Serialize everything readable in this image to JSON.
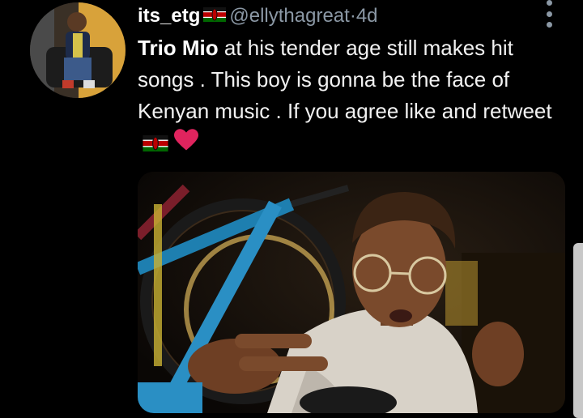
{
  "tweet": {
    "display_name": "its_etg",
    "handle": "@ellythagreat",
    "separator": " · ",
    "time": "4d",
    "text_bold": "Trio Mio",
    "text_body": " at his tender age still makes hit songs . This boy is gonna be the face of Kenyan music . If you agree like and retweet",
    "emoji": [
      "kenya-flag",
      "heart"
    ]
  },
  "colors": {
    "background": "#000000",
    "text": "#f2f2f2",
    "secondary": "#8b98a5",
    "heart": "#e0245e"
  }
}
